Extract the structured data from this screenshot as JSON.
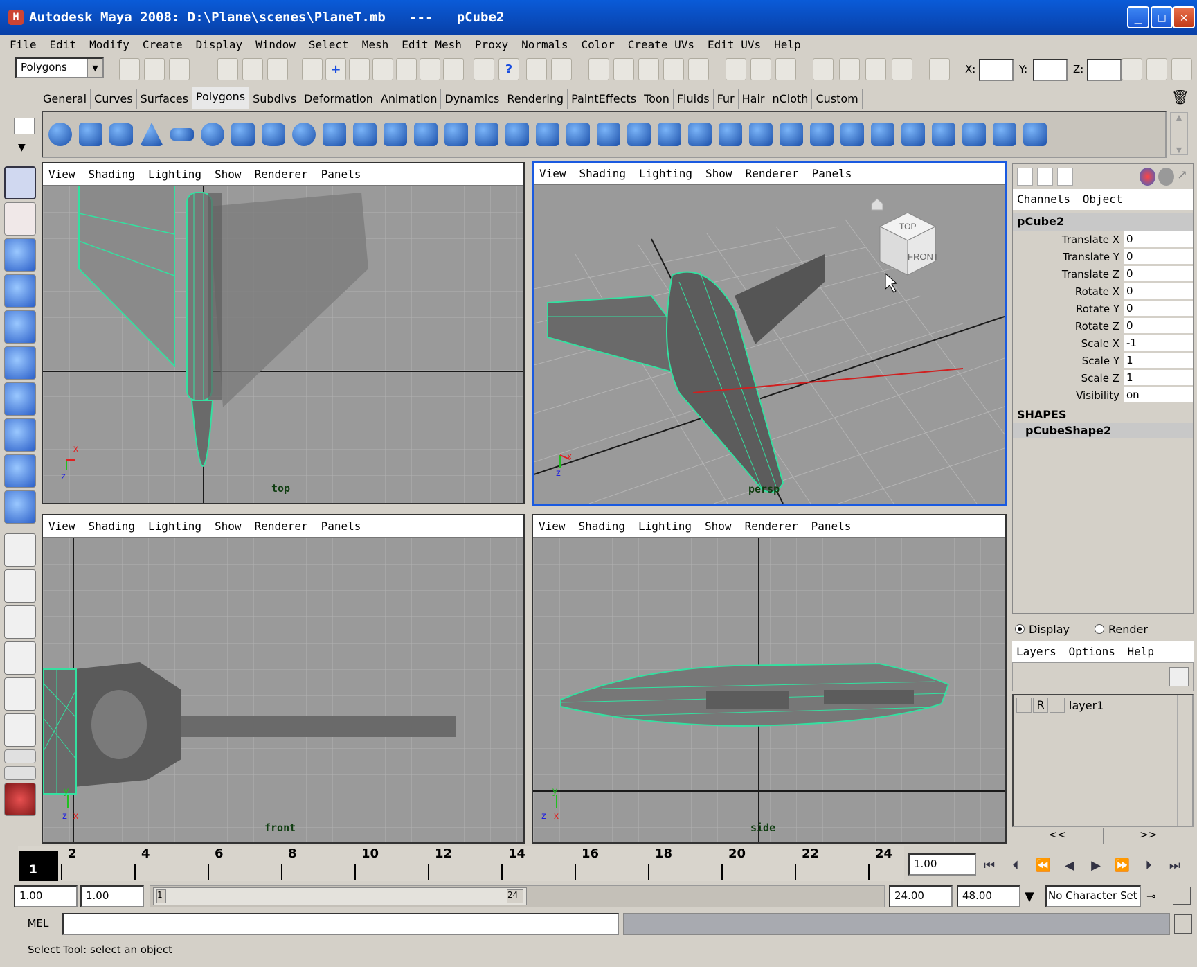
{
  "window": {
    "title": "Autodesk Maya 2008: D:\\Plane\\scenes\\PlaneT.mb   ---   pCube2",
    "minimize": "_",
    "maximize": "□",
    "close": "✕"
  },
  "menubar": [
    "File",
    "Edit",
    "Modify",
    "Create",
    "Display",
    "Window",
    "Select",
    "Mesh",
    "Edit Mesh",
    "Proxy",
    "Normals",
    "Color",
    "Create UVs",
    "Edit UVs",
    "Help"
  ],
  "statusline": {
    "mode": "Polygons",
    "x_label": "X:",
    "y_label": "Y:",
    "z_label": "Z:"
  },
  "shelf_tabs": [
    "General",
    "Curves",
    "Surfaces",
    "Polygons",
    "Subdivs",
    "Deformation",
    "Animation",
    "Dynamics",
    "Rendering",
    "PaintEffects",
    "Toon",
    "Fluids",
    "Fur",
    "Hair",
    "nCloth",
    "Custom"
  ],
  "active_shelf": "Polygons",
  "viewport_menu": [
    "View",
    "Shading",
    "Lighting",
    "Show",
    "Renderer",
    "Panels"
  ],
  "viewports": {
    "top": "top",
    "persp": "persp",
    "front": "front",
    "side": "side"
  },
  "viewcube": {
    "top": "TOP",
    "front": "FRONT"
  },
  "channelbox": {
    "menu": [
      "Channels",
      "Object"
    ],
    "object": "pCube2",
    "attributes": [
      {
        "name": "Translate X",
        "value": "0"
      },
      {
        "name": "Translate Y",
        "value": "0"
      },
      {
        "name": "Translate Z",
        "value": "0"
      },
      {
        "name": "Rotate X",
        "value": "0"
      },
      {
        "name": "Rotate Y",
        "value": "0"
      },
      {
        "name": "Rotate Z",
        "value": "0"
      },
      {
        "name": "Scale X",
        "value": "-1"
      },
      {
        "name": "Scale Y",
        "value": "1"
      },
      {
        "name": "Scale Z",
        "value": "1"
      },
      {
        "name": "Visibility",
        "value": "on"
      }
    ],
    "shapes_header": "SHAPES",
    "shape": "pCubeShape2"
  },
  "layers": {
    "display": "Display",
    "render": "Render",
    "menu": [
      "Layers",
      "Options",
      "Help"
    ],
    "layer_r": "R",
    "layer_name": "layer1",
    "prev": "<<",
    "next": ">>"
  },
  "timeline": {
    "current": "1",
    "ticks": [
      "2",
      "4",
      "6",
      "8",
      "10",
      "12",
      "14",
      "16",
      "18",
      "20",
      "22",
      "24"
    ],
    "current_time": "1.00"
  },
  "range": {
    "start": "1.00",
    "playback_start": "1.00",
    "slider_start": "1",
    "slider_end": "24",
    "playback_end": "24.00",
    "end": "48.00",
    "character_set": "No Character Set"
  },
  "command": {
    "label": "MEL"
  },
  "help_line": "Select Tool: select an object",
  "colors": {
    "title_bar": "#0a5bd8",
    "wire": "#34e0a0",
    "active_border": "#1a5ae0"
  }
}
